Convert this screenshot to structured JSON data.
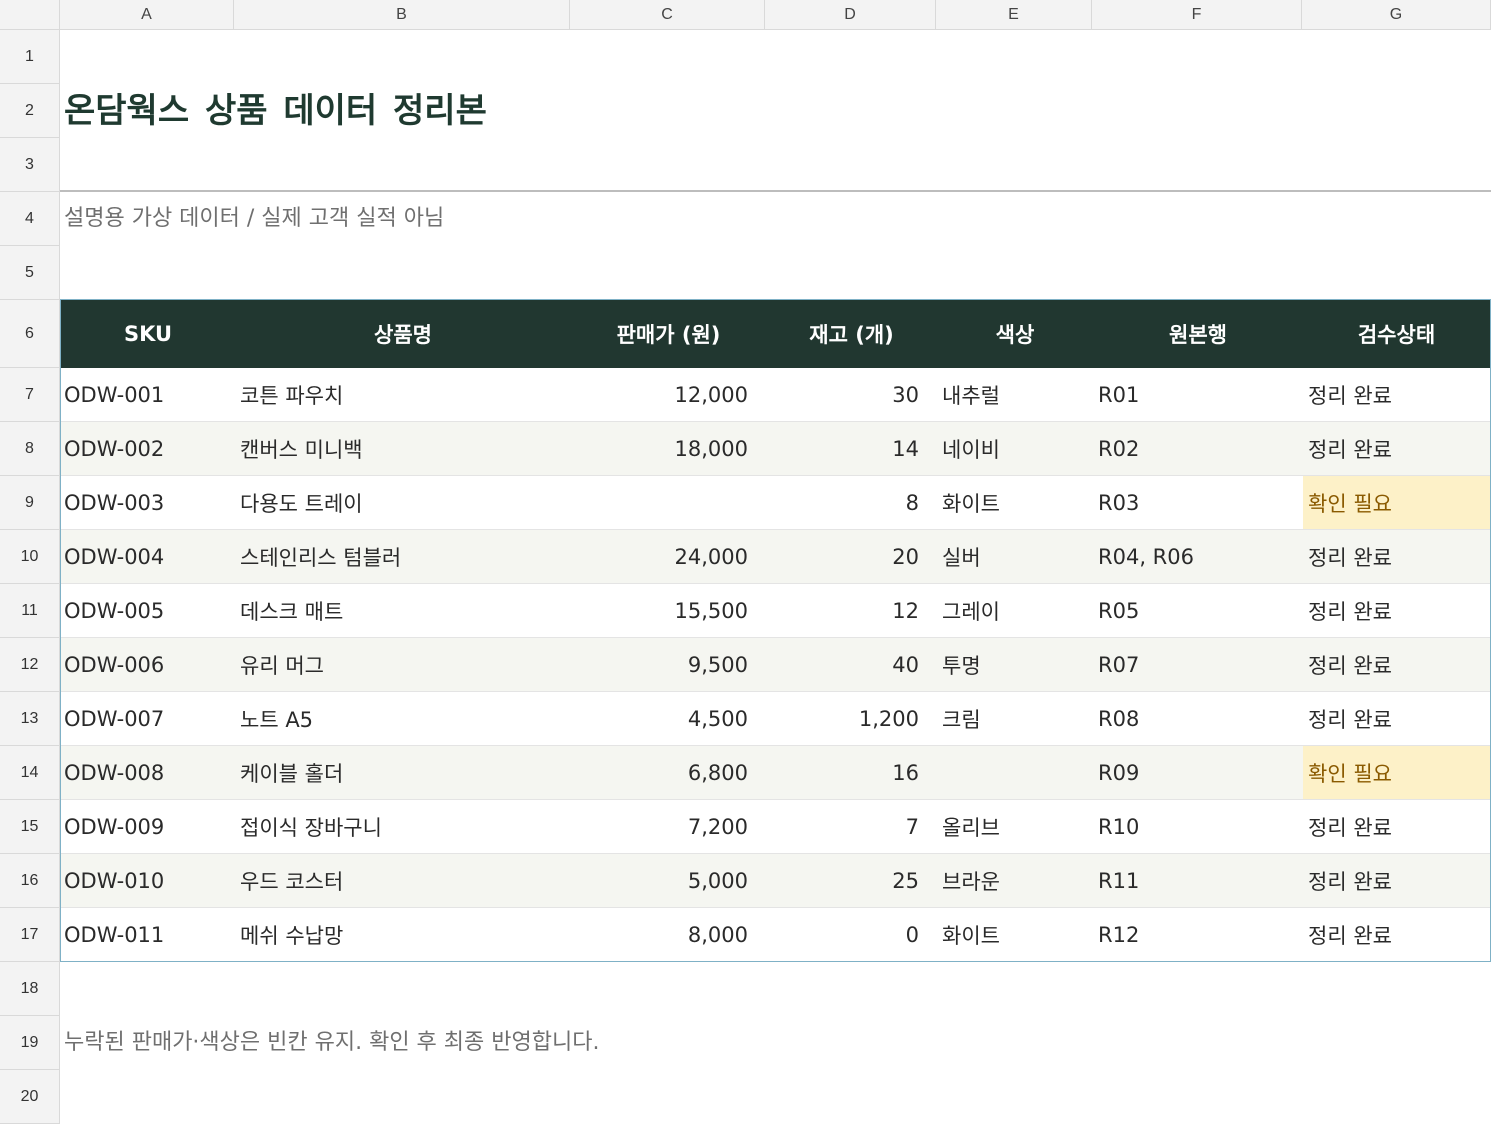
{
  "columns": [
    "A",
    "B",
    "C",
    "D",
    "E",
    "F",
    "G"
  ],
  "rows": [
    "1",
    "2",
    "3",
    "4",
    "5",
    "6",
    "7",
    "8",
    "9",
    "10",
    "11",
    "12",
    "13",
    "14",
    "15",
    "16",
    "17",
    "18",
    "19",
    "20"
  ],
  "title": "온담웍스  상품 데이터 정리본",
  "subtitle": "설명용 가상 데이터 / 실제 고객 실적 아님",
  "table": {
    "headers": [
      "SKU",
      "상품명",
      "판매가 (원)",
      "재고 (개)",
      "색상",
      "원본행",
      "검수상태"
    ],
    "rows": [
      {
        "sku": "ODW-001",
        "name": "코튼 파우치",
        "price": "12,000",
        "stock": "30",
        "color": "내추럴",
        "source": "R01",
        "status": "정리 완료",
        "flag": false
      },
      {
        "sku": "ODW-002",
        "name": "캔버스 미니백",
        "price": "18,000",
        "stock": "14",
        "color": "네이비",
        "source": "R02",
        "status": "정리 완료",
        "flag": false
      },
      {
        "sku": "ODW-003",
        "name": "다용도 트레이",
        "price": "",
        "stock": "8",
        "color": "화이트",
        "source": "R03",
        "status": "확인 필요",
        "flag": true
      },
      {
        "sku": "ODW-004",
        "name": "스테인리스 텀블러",
        "price": "24,000",
        "stock": "20",
        "color": "실버",
        "source": "R04, R06",
        "status": "정리 완료",
        "flag": false
      },
      {
        "sku": "ODW-005",
        "name": "데스크 매트",
        "price": "15,500",
        "stock": "12",
        "color": "그레이",
        "source": "R05",
        "status": "정리 완료",
        "flag": false
      },
      {
        "sku": "ODW-006",
        "name": "유리 머그",
        "price": "9,500",
        "stock": "40",
        "color": "투명",
        "source": "R07",
        "status": "정리 완료",
        "flag": false
      },
      {
        "sku": "ODW-007",
        "name": "노트 A5",
        "price": "4,500",
        "stock": "1,200",
        "color": "크림",
        "source": "R08",
        "status": "정리 완료",
        "flag": false
      },
      {
        "sku": "ODW-008",
        "name": "케이블 홀더",
        "price": "6,800",
        "stock": "16",
        "color": "",
        "source": "R09",
        "status": "확인 필요",
        "flag": true
      },
      {
        "sku": "ODW-009",
        "name": "접이식 장바구니",
        "price": "7,200",
        "stock": "7",
        "color": "올리브",
        "source": "R10",
        "status": "정리 완료",
        "flag": false
      },
      {
        "sku": "ODW-010",
        "name": "우드 코스터",
        "price": "5,000",
        "stock": "25",
        "color": "브라운",
        "source": "R11",
        "status": "정리 완료",
        "flag": false
      },
      {
        "sku": "ODW-011",
        "name": "메쉬 수납망",
        "price": "8,000",
        "stock": "0",
        "color": "화이트",
        "source": "R12",
        "status": "정리 완료",
        "flag": false
      }
    ]
  },
  "note": "누락된 판매가·색상은 빈칸 유지. 확인 후 최종 반영합니다.",
  "colors": {
    "header_bg": "#213730",
    "title": "#1f3a30",
    "warn_bg": "#fdf1c8",
    "warn_text": "#8a5a00",
    "table_border": "#7fb1c6"
  }
}
